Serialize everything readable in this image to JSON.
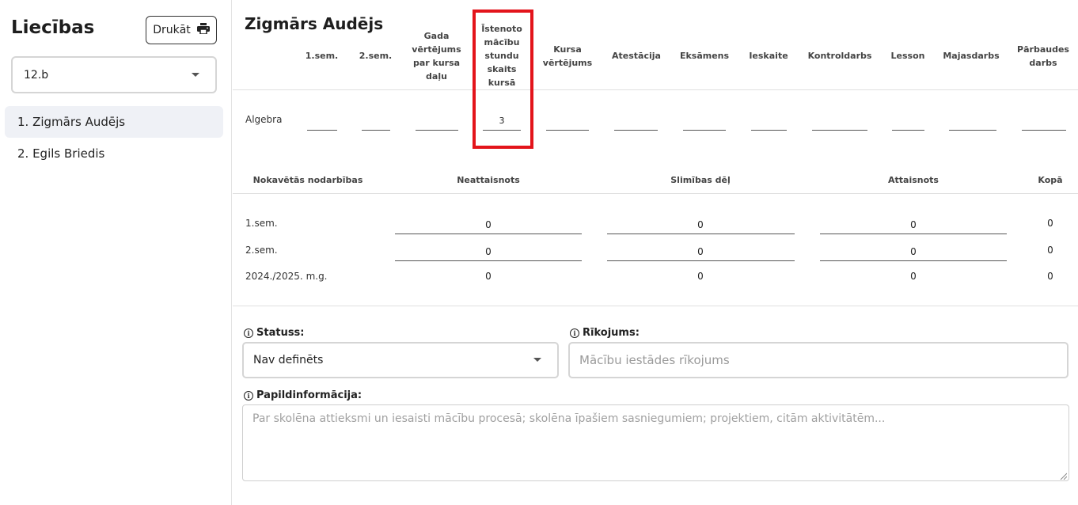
{
  "sidebar": {
    "title": "Liecības",
    "print_label": "Drukāt",
    "class_value": "12.b",
    "students": [
      {
        "label": "1. Zigmārs Audējs",
        "active": true
      },
      {
        "label": "2. Egils Briedis",
        "active": false
      }
    ]
  },
  "main": {
    "student_name": "Zigmārs Audējs",
    "grade_headers": {
      "sem1": "1.sem.",
      "sem2": "2.sem.",
      "year_part": [
        "Gada",
        "vērtējums",
        "par kursa",
        "daļu"
      ],
      "hours": [
        "Īstenoto",
        "mācību",
        "stundu",
        "skaits",
        "kursā"
      ],
      "course": [
        "Kursa",
        "vērtējums"
      ],
      "attestation": "Atestācija",
      "exam": "Eksāmens",
      "credit": "Ieskaite",
      "test": "Kontroldarbs",
      "lesson": "Lesson",
      "homework": "Majasdarbs",
      "check": [
        "Pārbaudes",
        "darbs"
      ]
    },
    "subject_row": {
      "subject": "Algebra",
      "hours_value": "3"
    },
    "absences": {
      "headers": {
        "label": "Nokavētās nodarbības",
        "unexcused": "Neattaisnots",
        "illness": "Slimības dēļ",
        "excused": "Attaisnots",
        "total": "Kopā"
      },
      "rows": [
        {
          "label": "1.sem.",
          "unexcused": "0",
          "illness": "0",
          "excused": "0",
          "total": "0"
        },
        {
          "label": "2.sem.",
          "unexcused": "0",
          "illness": "0",
          "excused": "0",
          "total": "0"
        },
        {
          "label": "2024./2025. m.g.",
          "unexcused": "0",
          "illness": "0",
          "excused": "0",
          "total": "0"
        }
      ]
    },
    "status": {
      "label": "Statuss:",
      "value": "Nav definēts"
    },
    "order": {
      "label": "Rīkojums:",
      "placeholder": "Mācību iestādes rīkojums"
    },
    "extra": {
      "label": "Papildinformācija:",
      "placeholder": "Par skolēna attieksmi un iesaisti mācību procesā; skolēna īpašiem sasniegumiem; projektiem, citām aktivitātēm..."
    }
  },
  "colors": {
    "highlight": "#e3141b",
    "active_item_bg": "#eff1f6",
    "border": "#d5d5d5"
  },
  "icons": {
    "print": "printer-icon",
    "dropdown": "caret-down-icon",
    "info": "info-circle-icon"
  }
}
